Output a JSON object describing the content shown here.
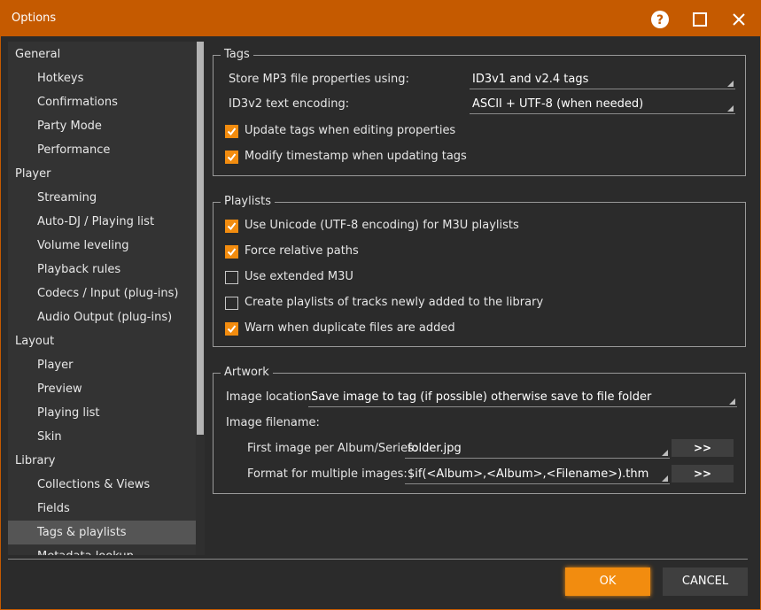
{
  "window": {
    "title": "Options",
    "colors": {
      "accent": "#c55a00",
      "checkbox": "#f28c0f",
      "ok_button": "#f28c0f"
    }
  },
  "titlebar_icons": [
    "help-icon",
    "maximize-icon",
    "close-icon"
  ],
  "sidebar": {
    "items": [
      {
        "label": "General",
        "level": 0
      },
      {
        "label": "Hotkeys",
        "level": 1
      },
      {
        "label": "Confirmations",
        "level": 1
      },
      {
        "label": "Party Mode",
        "level": 1
      },
      {
        "label": "Performance",
        "level": 1
      },
      {
        "label": "Player",
        "level": 0
      },
      {
        "label": "Streaming",
        "level": 1
      },
      {
        "label": "Auto-DJ / Playing list",
        "level": 1
      },
      {
        "label": "Volume leveling",
        "level": 1
      },
      {
        "label": "Playback rules",
        "level": 1
      },
      {
        "label": "Codecs / Input (plug-ins)",
        "level": 1
      },
      {
        "label": "Audio Output (plug-ins)",
        "level": 1
      },
      {
        "label": "Layout",
        "level": 0
      },
      {
        "label": "Player",
        "level": 1
      },
      {
        "label": "Preview",
        "level": 1
      },
      {
        "label": "Playing list",
        "level": 1
      },
      {
        "label": "Skin",
        "level": 1
      },
      {
        "label": "Library",
        "level": 0
      },
      {
        "label": "Collections & Views",
        "level": 1
      },
      {
        "label": "Fields",
        "level": 1
      },
      {
        "label": "Tags & playlists",
        "level": 1,
        "selected": true
      },
      {
        "label": "Metadata lookup",
        "level": 1
      }
    ]
  },
  "tags": {
    "title": "Tags",
    "store_label": "Store MP3 file properties using:",
    "store_value": "ID3v1 and v2.4 tags",
    "encoding_label": "ID3v2 text encoding:",
    "encoding_value": "ASCII + UTF-8 (when needed)",
    "update_tags": {
      "label": "Update tags when editing properties",
      "checked": true
    },
    "modify_timestamp": {
      "label": "Modify timestamp when updating tags",
      "checked": true
    }
  },
  "playlists": {
    "title": "Playlists",
    "use_unicode": {
      "label": "Use Unicode (UTF-8 encoding) for M3U playlists",
      "checked": true
    },
    "force_relative": {
      "label": "Force relative paths",
      "checked": true
    },
    "extended_m3u": {
      "label": "Use extended M3U",
      "checked": false
    },
    "create_playlists": {
      "label": "Create playlists of tracks newly added to the library",
      "checked": false
    },
    "warn_duplicate": {
      "label": "Warn when duplicate files are added",
      "checked": true
    }
  },
  "artwork": {
    "title": "Artwork",
    "location_label": "Image location:",
    "location_value": "Save image to tag (if possible) otherwise save to file folder",
    "filename_label": "Image filename:",
    "first_label": "First image per Album/Series:",
    "first_value": "folder.jpg",
    "multiple_label": "Format for multiple images:",
    "multiple_value": "$if(<Album>,<Album>,<Filename>).thm",
    "browse_label": ">>"
  },
  "footer": {
    "ok": "OK",
    "cancel": "CANCEL"
  }
}
